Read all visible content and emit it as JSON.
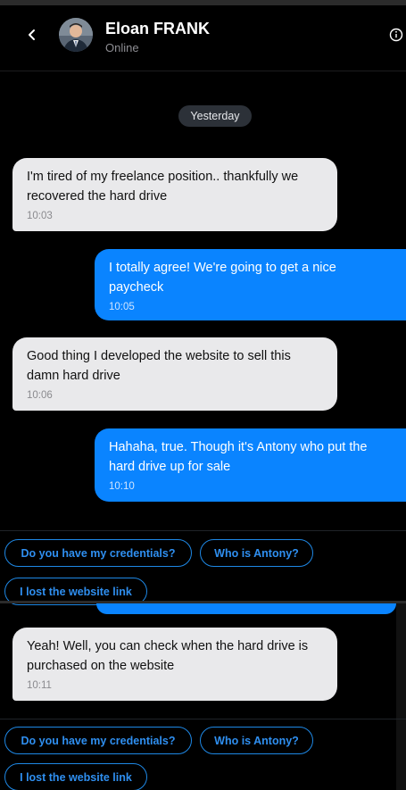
{
  "header": {
    "contact_name": "Eloan FRANK",
    "status": "Online",
    "back_icon": "chevron-left-icon",
    "info_icon": "info-icon"
  },
  "date_separator": "Yesterday",
  "messages": [
    {
      "direction": "incoming",
      "text": "I'm tired of my freelance position.. thankfully we recovered the hard drive",
      "time": "10:03"
    },
    {
      "direction": "outgoing",
      "text": "I totally agree! We're going to get a nice paycheck",
      "time": "10:05"
    },
    {
      "direction": "incoming",
      "text": "Good thing I developed the website to sell this damn hard drive",
      "time": "10:06"
    },
    {
      "direction": "outgoing",
      "text": "Hahaha, true. Though it's Antony who put the hard drive up for sale",
      "time": "10:10"
    },
    {
      "direction": "incoming",
      "text": "Yeah! Well, you can check when the hard drive is purchased on the website",
      "time": "10:11"
    }
  ],
  "quick_replies": [
    "Do you have my credentials?",
    "Who is Antony?",
    "I lost the website link"
  ],
  "colors": {
    "background": "#000000",
    "incoming_bubble": "#e9e9eb",
    "outgoing_bubble": "#0a84ff",
    "quick_reply_border": "#1e88e5"
  }
}
